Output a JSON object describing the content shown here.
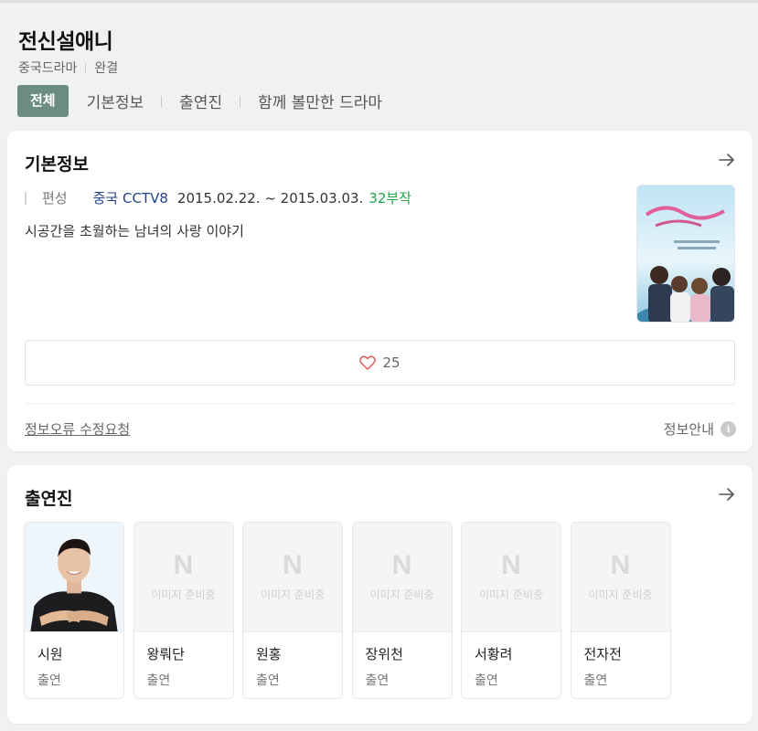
{
  "header": {
    "title": "전신설애니",
    "genre": "중국드라마",
    "status": "완결"
  },
  "tabs": [
    {
      "label": "전체",
      "active": true
    },
    {
      "label": "기본정보"
    },
    {
      "label": "출연진"
    },
    {
      "label": "함께 볼만한 드라마"
    }
  ],
  "basic_info": {
    "title": "기본정보",
    "label": "편성",
    "network": "중국 CCTV8",
    "dates": "2015.02.22. ~ 2015.03.03.",
    "episodes": "32부작",
    "description": "시공간을 초월하는 남녀의 사랑 이야기",
    "likes": "25",
    "report_link": "정보오류 수정요청",
    "guide_link": "정보안내",
    "guide_icon": "i"
  },
  "cast": {
    "title": "출연진",
    "placeholder_logo": "N",
    "placeholder_text": "이미지 준비중",
    "members": [
      {
        "name": "시원",
        "role": "출연"
      },
      {
        "name": "왕뤄단",
        "role": "출연"
      },
      {
        "name": "원홍",
        "role": "출연"
      },
      {
        "name": "장위천",
        "role": "출연"
      },
      {
        "name": "서황려",
        "role": "출연"
      },
      {
        "name": "전자전",
        "role": "출연"
      }
    ]
  },
  "colors": {
    "accent": "#6e8d82",
    "link": "#24428a",
    "episodes": "#26a24a",
    "heart": "#e55a5a"
  }
}
